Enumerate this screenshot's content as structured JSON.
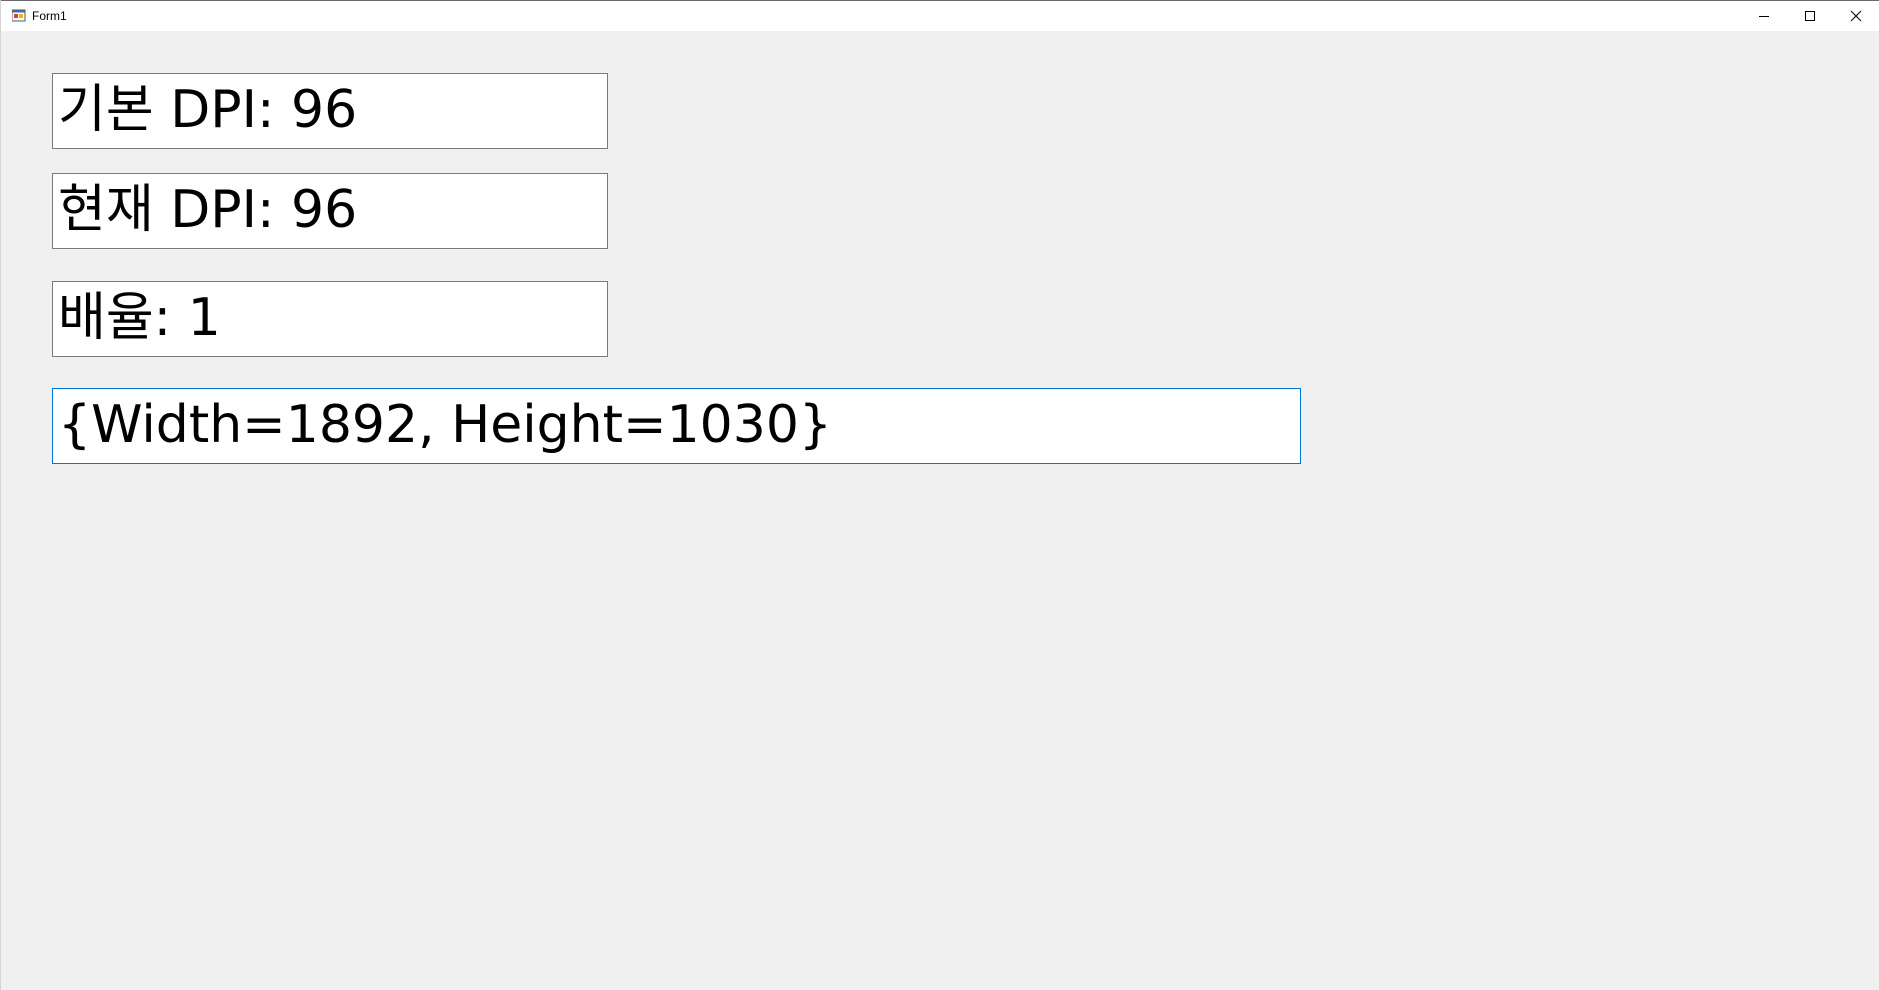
{
  "window": {
    "title": "Form1"
  },
  "fields": {
    "base_dpi": "기본 DPI: 96",
    "current_dpi": "현재 DPI: 96",
    "scale": "배율: 1",
    "size": "{Width=1892, Height=1030}"
  },
  "colors": {
    "background": "#f0f0f0",
    "field_background": "#ffffff",
    "field_border": "#7a7a7a",
    "focus_border": "#0078d7"
  }
}
